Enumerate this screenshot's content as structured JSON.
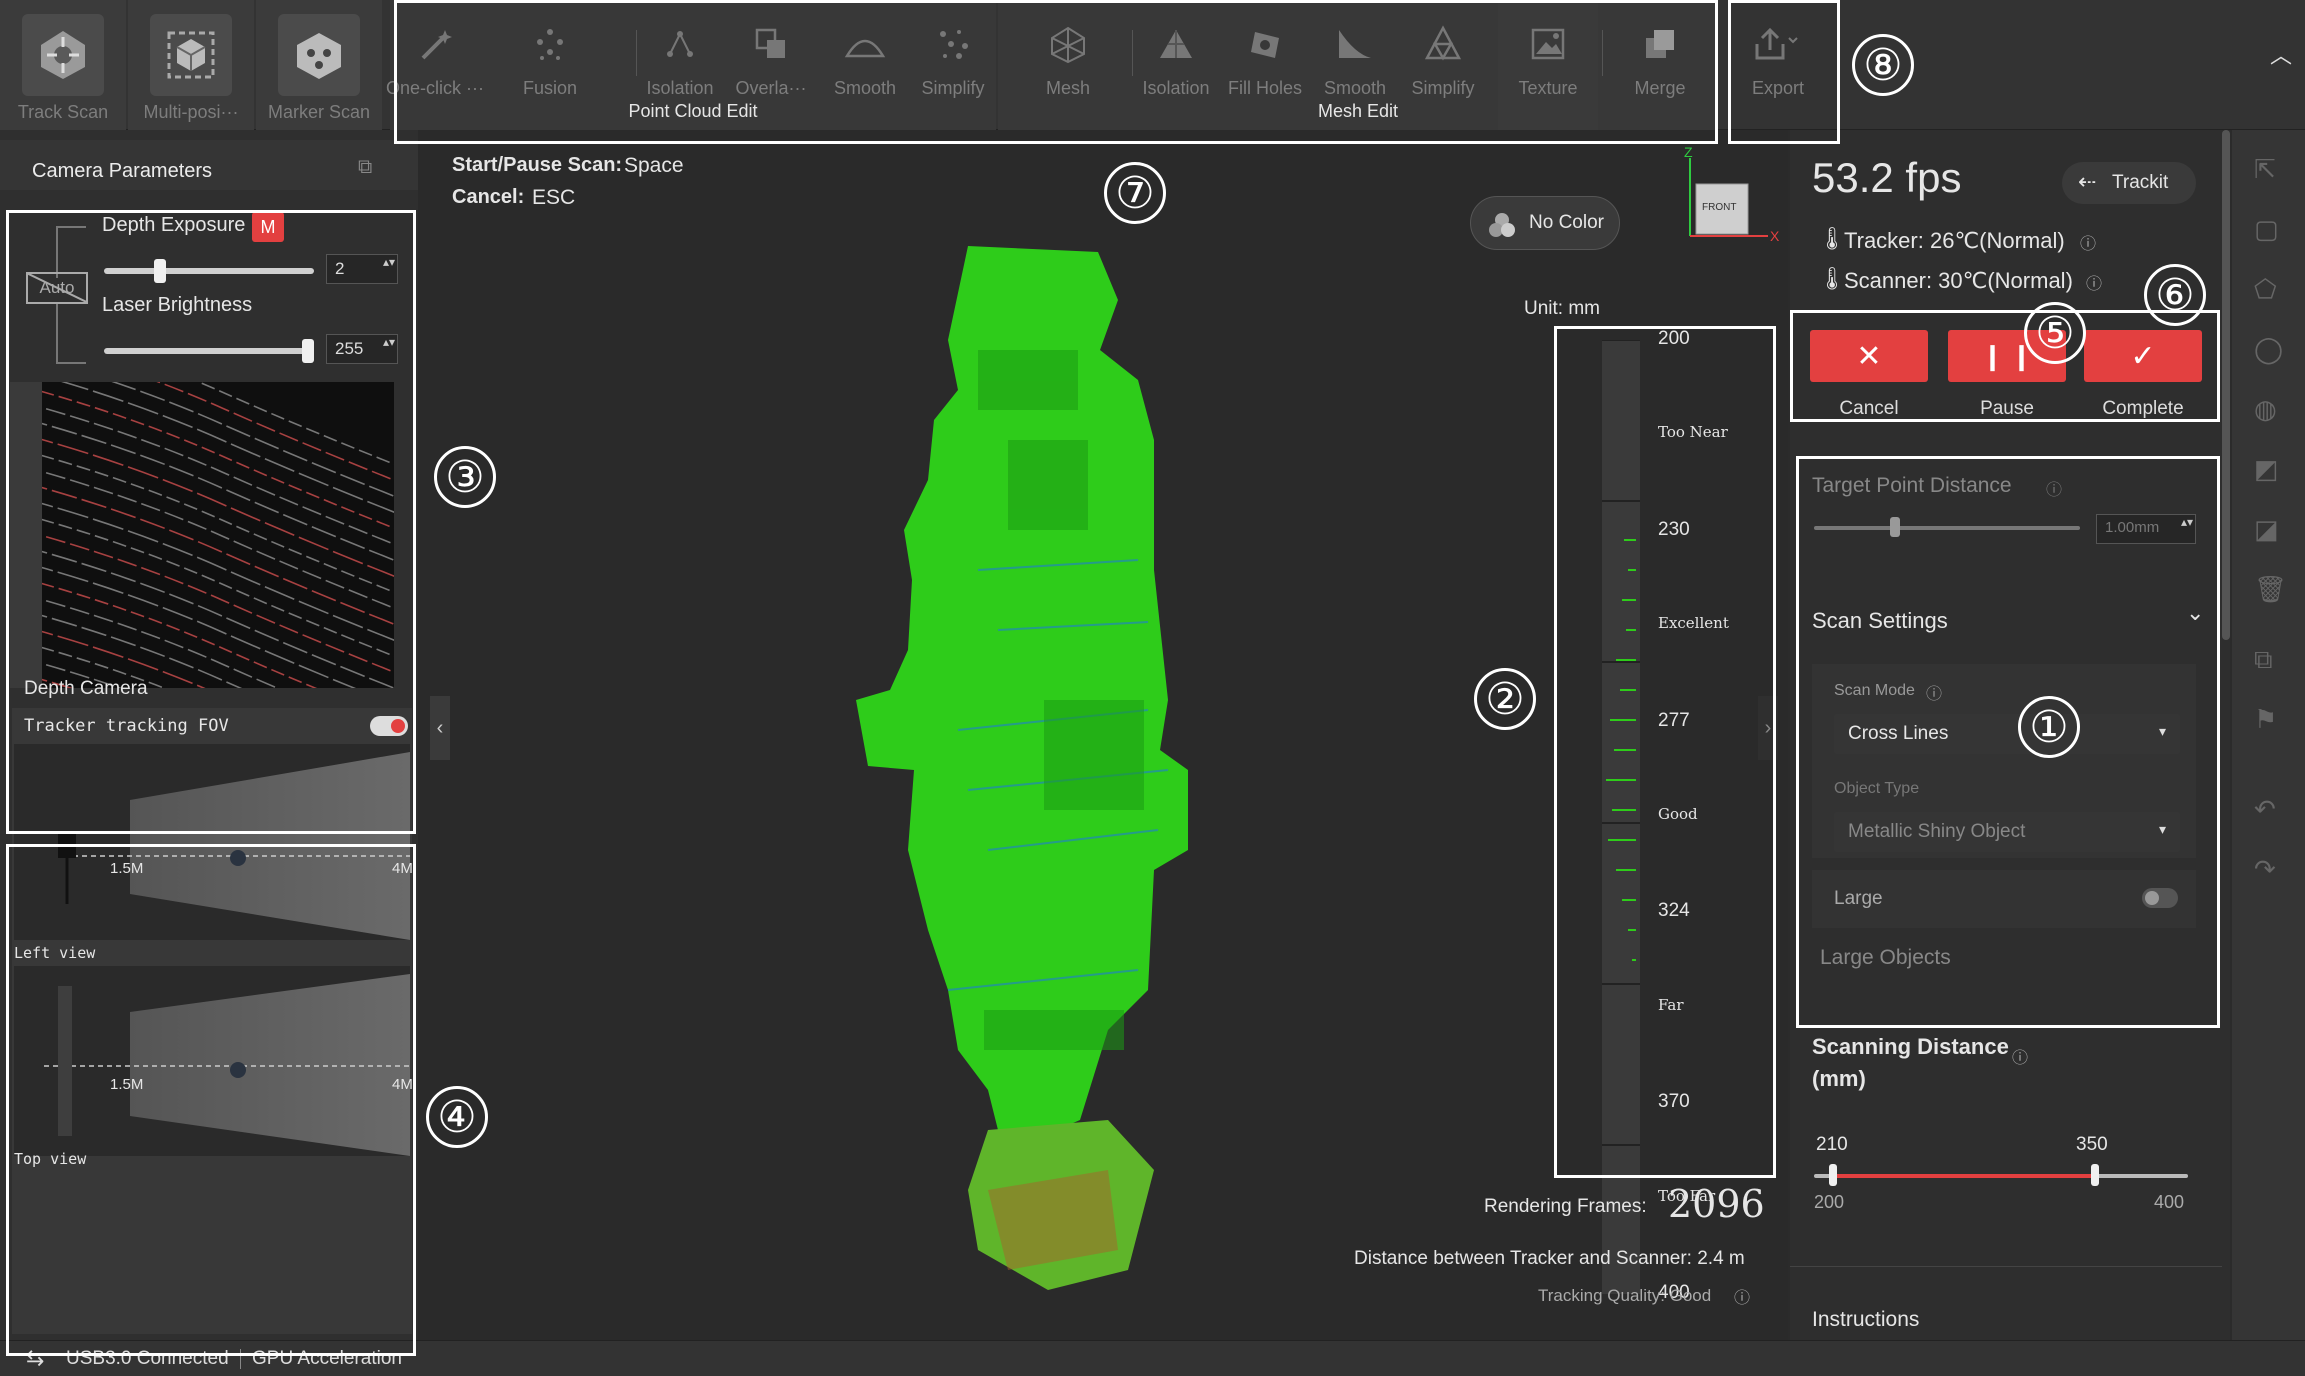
{
  "toolbar": {
    "modes": [
      {
        "label": "Track Scan",
        "icon": "track-scan-icon"
      },
      {
        "label": "Multi-posi···",
        "icon": "multi-position-icon"
      },
      {
        "label": "Marker Scan",
        "icon": "marker-scan-icon"
      }
    ],
    "point_cloud_group": "Point Cloud Edit",
    "point_cloud_tools": [
      "One-click ···",
      "Fusion",
      "Isolation",
      "Overla···",
      "Smooth",
      "Simplify"
    ],
    "mesh_group": "Mesh Edit",
    "mesh_tools": [
      "Mesh",
      "Isolation",
      "Fill Holes",
      "Smooth",
      "Simplify",
      "Texture",
      "Merge"
    ],
    "export_label": "Export"
  },
  "callouts": [
    "①",
    "②",
    "③",
    "④",
    "⑤",
    "⑥",
    "⑦",
    "⑧"
  ],
  "left": {
    "title": "Camera Parameters",
    "depth_exposure": {
      "label": "Depth Exposure",
      "badge": "M",
      "value": "2",
      "fraction": 0.25
    },
    "auto_label": "Auto",
    "laser_brightness": {
      "label": "Laser Brightness",
      "value": "255",
      "fraction": 1.0
    },
    "depth_camera_label": "Depth Camera",
    "fov_label": "Tracker tracking FOV",
    "fov_toggle_on": true,
    "near_mark": "1.5M",
    "far_mark": "4M",
    "left_view": "Left view",
    "top_view": "Top view"
  },
  "viewport": {
    "shortcut_scan_key": "Start/Pause Scan:",
    "shortcut_scan_val": "Space",
    "shortcut_cancel_key": "Cancel:",
    "shortcut_cancel_val": "ESC",
    "color_mode": "No Color",
    "axis_z": "Z",
    "axis_x": "X",
    "cube_label": "FRONT",
    "unit": "Unit: mm",
    "gauge_ticks": [
      {
        "label": "200",
        "kind": "num"
      },
      {
        "label": "Too Near",
        "kind": "zone"
      },
      {
        "label": "230",
        "kind": "num"
      },
      {
        "label": "Excellent",
        "kind": "zone"
      },
      {
        "label": "277",
        "kind": "num"
      },
      {
        "label": "Good",
        "kind": "zone"
      },
      {
        "label": "324",
        "kind": "num"
      },
      {
        "label": "Far",
        "kind": "zone"
      },
      {
        "label": "370",
        "kind": "num"
      },
      {
        "label": "Too Far",
        "kind": "zone"
      },
      {
        "label": "400",
        "kind": "num"
      }
    ],
    "rendering_label": "Rendering Frames:",
    "rendering_value": "2096",
    "distance_text": "Distance between Tracker and Scanner: 2.4 m",
    "tracking_quality": "Tracking Quality: Good"
  },
  "right": {
    "fps": "53.2 fps",
    "trackit": "Trackit",
    "tracker_temp": "Tracker: 26℃(Normal)",
    "scanner_temp": "Scanner: 30℃(Normal)",
    "cancel": "Cancel",
    "pause": "Pause",
    "complete": "Complete",
    "target_point_distance": "Target Point Distance",
    "target_value": "1.00mm",
    "scan_settings": "Scan Settings",
    "scan_mode_label": "Scan Mode",
    "scan_mode_value": "Cross Lines",
    "object_type_label": "Object Type",
    "object_type_value": "Metallic Shiny Object",
    "large_label": "Large",
    "large_objects": "Large Objects",
    "scanning_distance_1": "Scanning Distance",
    "scanning_distance_2": "(mm)",
    "range_low": "210",
    "range_high": "350",
    "range_min": "200",
    "range_max": "400",
    "instructions": "Instructions"
  },
  "status": {
    "usb": "USB3.0 Connected",
    "gpu": "GPU Acceleration"
  },
  "colors": {
    "accent_red": "#e34040",
    "cloud_green": "#2ecc1a",
    "cloud_blue": "#1e7bd6"
  }
}
